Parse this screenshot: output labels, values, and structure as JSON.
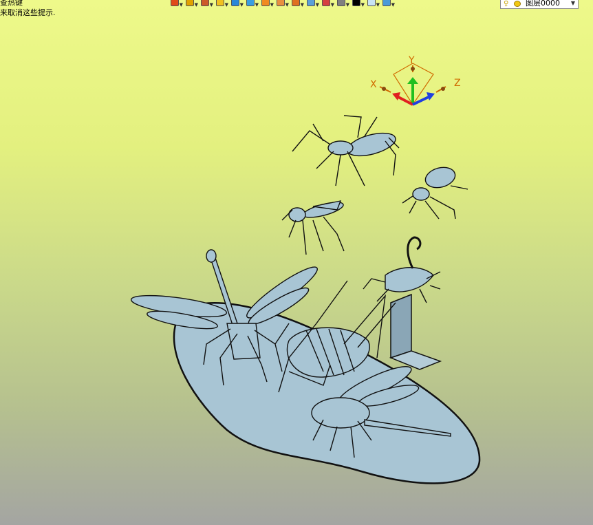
{
  "hints": {
    "line1": "查热键",
    "line2": "来取消这些提示."
  },
  "toolbar": {
    "buttons": [
      {
        "name": "undo-icon",
        "color": "#e04a1a"
      },
      {
        "name": "layers-stack-icon",
        "color": "#e0a200"
      },
      {
        "name": "pencil-icon",
        "color": "#cc5a2a"
      },
      {
        "name": "yellow-box-icon",
        "color": "#f0c020"
      },
      {
        "name": "blue-cube-icon",
        "color": "#2a88d8"
      },
      {
        "name": "blue-cube-2-icon",
        "color": "#3a9ee0"
      },
      {
        "name": "color-wheel-icon",
        "color": "#f08a20"
      },
      {
        "name": "render-sphere-icon",
        "color": "#e89040"
      },
      {
        "name": "snap-target-icon",
        "color": "#e07020"
      },
      {
        "name": "page-icon",
        "color": "#5ba0d8"
      },
      {
        "name": "frame-icon",
        "color": "#d64040"
      },
      {
        "name": "stack-grey-icon",
        "color": "#808080"
      },
      {
        "name": "black-swatch-icon",
        "color": "#000000"
      },
      {
        "name": "light-swatch-icon",
        "color": "#c8e4f4"
      },
      {
        "name": "layers-icon",
        "color": "#4a9ad8"
      }
    ],
    "layer_select": "图层0000"
  },
  "triad": {
    "x": "X",
    "y": "Y",
    "z": "Z"
  },
  "colors": {
    "model_fill": "#a8c5d4",
    "model_outline": "#111111",
    "axis_x": "#e02020",
    "axis_y": "#20c020",
    "axis_z": "#2040e0",
    "axis_label": "#d06a00"
  }
}
